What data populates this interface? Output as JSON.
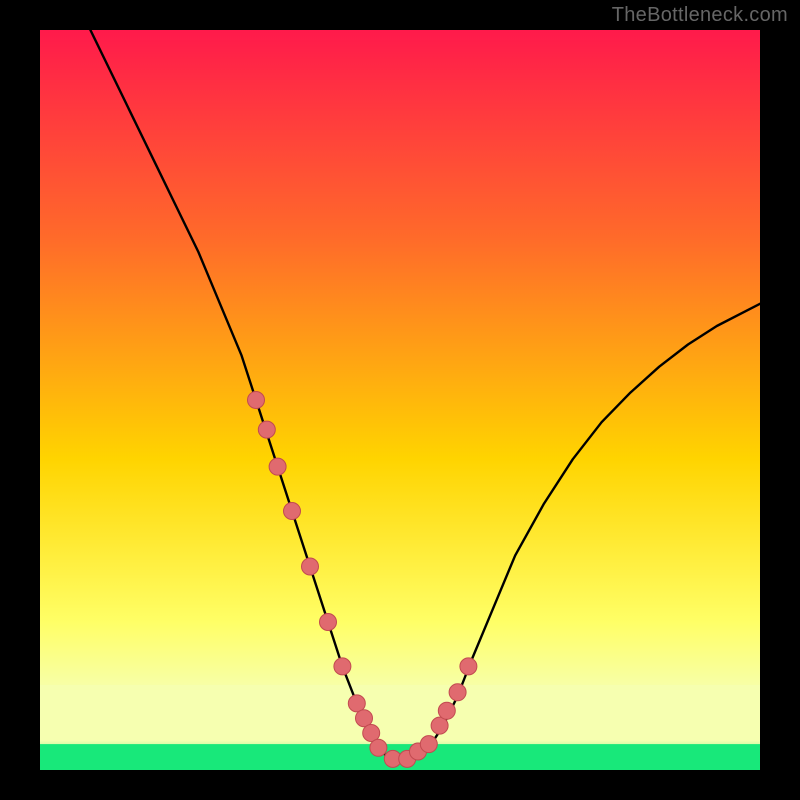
{
  "watermark": "TheBottleneck.com",
  "colors": {
    "gradient_top": "#ff1a4b",
    "gradient_mid1": "#ff6a2a",
    "gradient_mid2": "#ffd400",
    "gradient_mid3": "#ffff66",
    "gradient_bottom_band": "#f6ffb0",
    "gradient_green": "#18e87a",
    "curve": "#000000",
    "marker_fill": "#e06a6f",
    "marker_stroke": "#c24a50"
  },
  "chart_data": {
    "type": "line",
    "title": "",
    "xlabel": "",
    "ylabel": "",
    "xlim": [
      0,
      100
    ],
    "ylim": [
      0,
      100
    ],
    "series": [
      {
        "name": "bottleneck-curve",
        "x": [
          7,
          10,
          13,
          16,
          19,
          22,
          25,
          28,
          30,
          32,
          34,
          36,
          38,
          40,
          42,
          44,
          45,
          46,
          47,
          48,
          49,
          50,
          52,
          54,
          56,
          58,
          60,
          63,
          66,
          70,
          74,
          78,
          82,
          86,
          90,
          94,
          98,
          100
        ],
        "y": [
          100,
          94,
          88,
          82,
          76,
          70,
          63,
          56,
          50,
          44,
          38,
          32,
          26,
          20,
          14,
          9,
          7,
          5,
          3,
          2,
          1.5,
          1,
          1.5,
          3,
          6,
          10,
          15,
          22,
          29,
          36,
          42,
          47,
          51,
          54.5,
          57.5,
          60,
          62,
          63
        ]
      }
    ],
    "markers": {
      "name": "highlight-points",
      "x": [
        30,
        31.5,
        33,
        35,
        37.5,
        40,
        42,
        44,
        45,
        46,
        47,
        49,
        51,
        52.5,
        54,
        55.5,
        56.5,
        58,
        59.5
      ],
      "y": [
        50,
        46,
        41,
        35,
        27.5,
        20,
        14,
        9,
        7,
        5,
        3,
        1.5,
        1.5,
        2.5,
        3.5,
        6,
        8,
        10.5,
        14
      ]
    }
  }
}
